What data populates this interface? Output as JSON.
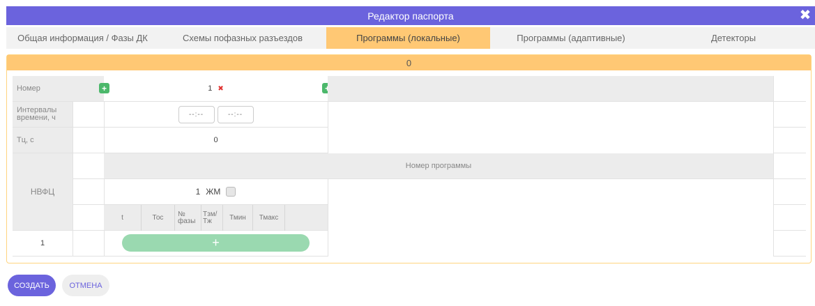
{
  "window": {
    "title": "Редактор паспорта"
  },
  "tabs": [
    {
      "label": "Общая информация / Фазы ДК",
      "active": false
    },
    {
      "label": "Схемы пофазных разъездов",
      "active": false
    },
    {
      "label": "Программы (локальные)",
      "active": true
    },
    {
      "label": "Программы (адаптивные)",
      "active": false
    },
    {
      "label": "Детекторы",
      "active": false
    }
  ],
  "panel": {
    "header_value": "0"
  },
  "grid": {
    "row_labels": {
      "number": "Номер",
      "intervals": "Интервалы времени, ч",
      "tc": "Тц, с",
      "nvfc": "НВФЦ"
    },
    "program_number": "1",
    "time_from": "--:--",
    "time_to": "--:--",
    "tc_value": "0",
    "program_number_header": "Номер программы",
    "phase_program_value": "1",
    "zhm_label": "ЖМ",
    "phase_columns": [
      "t",
      "Тос",
      "№ фазы",
      "Тзм/ Тж",
      "Тмин",
      "Тмакс"
    ],
    "row_index": "1"
  },
  "icons": {
    "add": "+",
    "remove": "✖",
    "close": "✖"
  },
  "buttons": {
    "create": "СОЗДАТЬ",
    "cancel": "ОТМЕНА"
  },
  "colors": {
    "title_bar": "#6b63dd",
    "active_tab": "#ffc874",
    "add_button": "#4cb86b",
    "create_button": "#6b63dd"
  }
}
